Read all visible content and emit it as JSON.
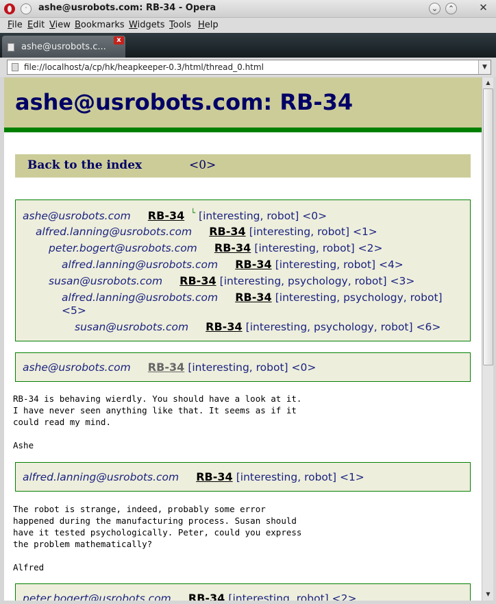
{
  "window": {
    "title": "ashe@usrobots.com: RB-34 - Opera",
    "menu_icon": "window-menu-icon"
  },
  "menubar": {
    "items": [
      "File",
      "Edit",
      "View",
      "Bookmarks",
      "Widgets",
      "Tools",
      "Help"
    ]
  },
  "tab": {
    "title": "ashe@usrobots.c...",
    "close": "x"
  },
  "address": {
    "url": "file://localhost/a/cp/hk/heapkeeper-0.3/html/thread_0.html"
  },
  "page": {
    "title": "ashe@usrobots.com: RB-34",
    "back_link": "Back to the index",
    "back_num": "<0>"
  },
  "thread": [
    {
      "author": "ashe@usrobots.com",
      "subject": "RB-34",
      "tags": "[interesting, robot] <0>",
      "mark": "└"
    },
    {
      "author": "alfred.lanning@usrobots.com",
      "subject": "RB-34",
      "tags": "[interesting, robot] <1>"
    },
    {
      "author": "peter.bogert@usrobots.com",
      "subject": "RB-34",
      "tags": "[interesting, robot] <2>"
    },
    {
      "author": "alfred.lanning@usrobots.com",
      "subject": "RB-34",
      "tags": "[interesting, robot] <4>"
    },
    {
      "author": "susan@usrobots.com",
      "subject": "RB-34",
      "tags": "[interesting, psychology, robot] <3>"
    },
    {
      "author": "alfred.lanning@usrobots.com",
      "subject": "RB-34",
      "tags": "[interesting, psychology, robot]",
      "tags_cont": "<5>"
    },
    {
      "author": "susan@usrobots.com",
      "subject": "RB-34",
      "tags": "[interesting, psychology, robot] <6>"
    }
  ],
  "messages": [
    {
      "author": "ashe@usrobots.com",
      "subject": "RB-34",
      "tags": "[interesting, robot] <0>",
      "body": "RB-34 is behaving wierdly. You should have a look at it.\nI have never seen anything like that. It seems as if it\ncould read my mind.\n\nAshe"
    },
    {
      "author": "alfred.lanning@usrobots.com",
      "subject": "RB-34",
      "tags": "[interesting, robot] <1>",
      "body": "The robot is strange, indeed, probably some error\nhappened during the manufacturing process. Susan should\nhave it tested psychologically. Peter, could you express\nthe problem mathematically?\n\nAlfred"
    },
    {
      "author": "peter.bogert@usrobots.com",
      "subject": "RB-34",
      "tags": "[interesting, robot] <2>"
    }
  ]
}
